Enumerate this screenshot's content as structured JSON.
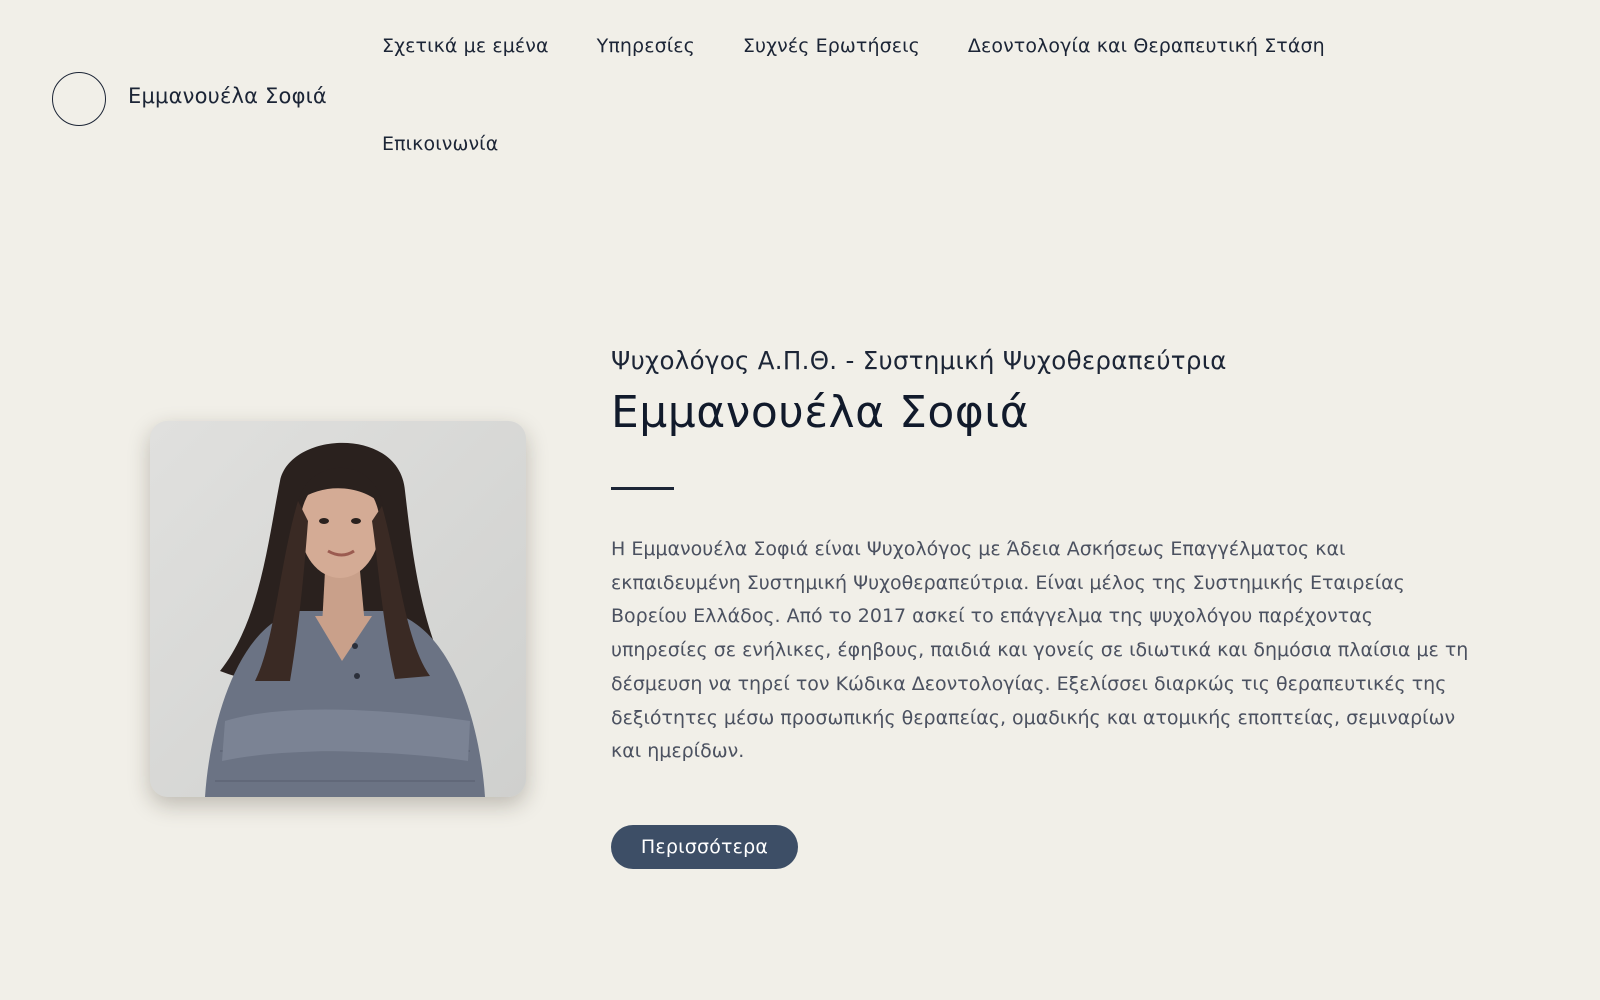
{
  "header": {
    "brand_name": "Εμμανουέλα Σοφιά",
    "nav": [
      {
        "label": "Σχετικά με εμένα"
      },
      {
        "label": "Υπηρεσίες"
      },
      {
        "label": "Συχνές Ερωτήσεις"
      },
      {
        "label": "Δεοντολογία και Θεραπευτική Στάση"
      },
      {
        "label": "Επικοινωνία"
      }
    ]
  },
  "hero": {
    "subtitle": "Ψυχολόγος Α.Π.Θ. - Συστημική Ψυχοθεραπεύτρια",
    "title": "Εμμανουέλα Σοφιά",
    "bio": "Η Εμμανουέλα Σοφιά είναι Ψυχολόγος με Άδεια Ασκήσεως Επαγγέλματος και εκπαιδευμένη Συστημική Ψυχοθεραπεύτρια. Είναι μέλος της Συστημικής Εταιρείας Βορείου Ελλάδος. Από το 2017 ασκεί το επάγγελμα της ψυχολόγου παρέχοντας υπηρεσίες σε ενήλικες, έφηβους, παιδιά και γονείς σε ιδιωτικά και δημόσια πλαίσια με τη δέσμευση να τηρεί τον Κώδικα Δεοντολογίας.  Εξελίσσει διαρκώς τις θεραπευτικές της δεξιότητες μέσω προσωπικής θεραπείας, ομαδικής και ατομικής εποπτείας, σεμιναρίων και ημερίδων.",
    "cta_label": "Περισσότερα"
  },
  "colors": {
    "background": "#f1efe8",
    "text": "#1c2536",
    "body_text": "#4b5160",
    "button": "#3d4e66"
  },
  "icons": {
    "logo": "circle-outline-icon"
  }
}
